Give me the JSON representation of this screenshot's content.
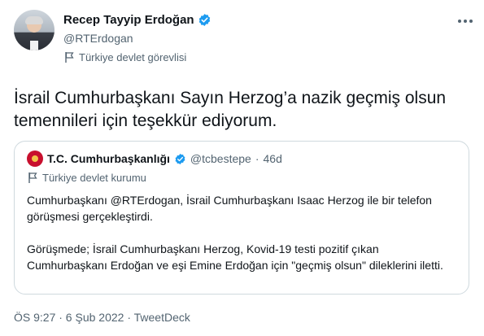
{
  "author": {
    "name": "Recep Tayyip Erdoğan",
    "handle": "@RTErdogan",
    "label": "Türkiye devlet görevlisi"
  },
  "tweet": {
    "text": "İsrail Cumhurbaşkanı Sayın Herzog’a nazik geçmiş olsun temennileri için teşekkür ediyorum."
  },
  "quoted": {
    "name": "T.C. Cumhurbaşkanlığı",
    "handle": "@tcbestepe",
    "separator": "·",
    "age": "46d",
    "label": "Türkiye devlet kurumu",
    "paragraph1": "Cumhurbaşkanı @RTErdogan, İsrail Cumhurbaşkanı Isaac Herzog ile bir telefon görüşmesi gerçekleştirdi.",
    "paragraph2": "Görüşmede; İsrail Cumhurbaşkanı Herzog, Kovid-19 testi pozitif çıkan Cumhurbaşkanı Erdoğan ve eşi Emine Erdoğan için \"geçmiş olsun\" dileklerini iletti."
  },
  "footer": {
    "meta": "ÖS 9:27 · 6 Şub 2022 · TweetDeck"
  },
  "colors": {
    "verified": "#1d9bf0",
    "secondary_text": "#536471",
    "border": "#cfd9de"
  },
  "icons": {
    "verified": "verified-badge-icon",
    "label": "flag-icon",
    "more": "more-options-icon"
  }
}
